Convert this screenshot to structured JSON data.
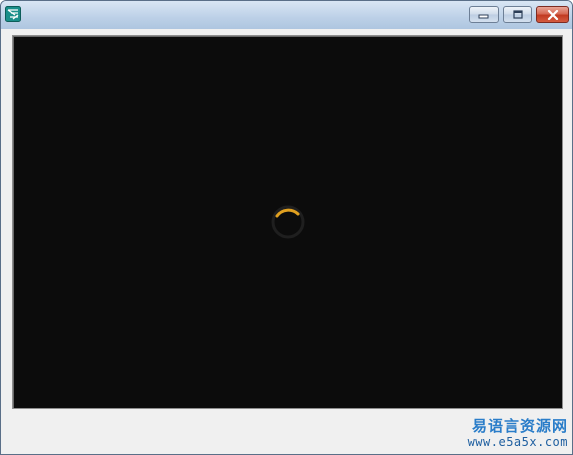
{
  "window": {
    "title": ""
  },
  "titlebar": {
    "buttons": [
      {
        "id": "minimize",
        "icon": "minimize-icon"
      },
      {
        "id": "maximize",
        "icon": "maximize-icon"
      },
      {
        "id": "close",
        "icon": "close-icon"
      }
    ]
  },
  "stage": {
    "background": "#0c0c0c",
    "loading": {
      "icon": "loading-spinner-icon",
      "accent": "#e0a020"
    }
  },
  "watermark": {
    "title": "易语言资源网",
    "url": "www.e5a5x.com"
  },
  "colors": {
    "titlebar": "#bcd0e7",
    "client": "#f0f0f0",
    "close_button": "#c23b22",
    "watermark": "#2a7dc9"
  }
}
